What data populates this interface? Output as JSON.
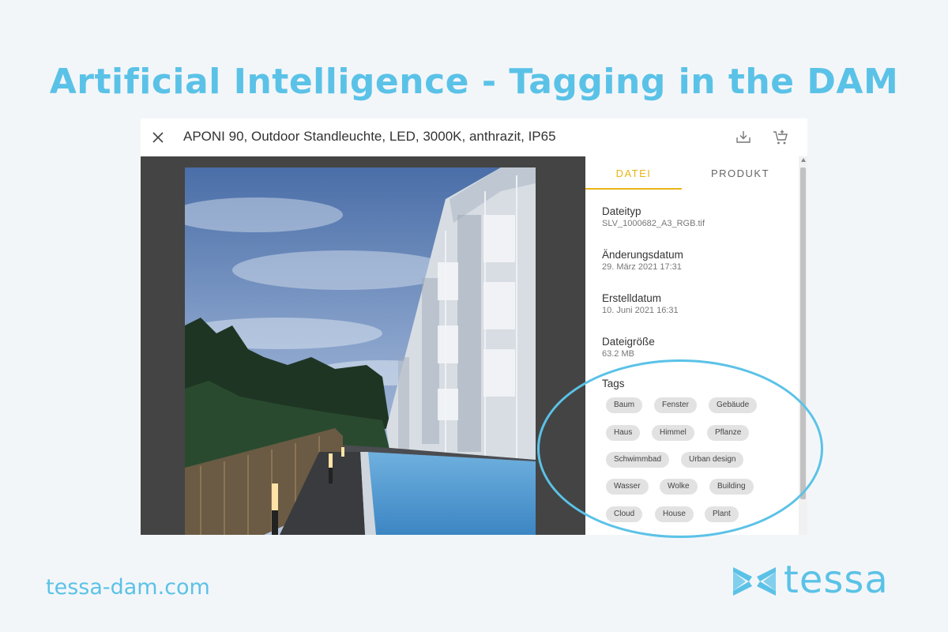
{
  "headline": "Artificial Intelligence - Tagging in the DAM",
  "modal": {
    "title": "APONI 90, Outdoor Standleuchte, LED, 3000K, anthrazit, IP65",
    "close_icon": "close-icon",
    "download_icon": "download-icon",
    "add_to_cart_icon": "cart-add-icon"
  },
  "panel": {
    "tabs": [
      {
        "label": "DATEI",
        "active": true
      },
      {
        "label": "PRODUKT",
        "active": false
      }
    ],
    "fields": [
      {
        "label": "Dateityp",
        "value": "SLV_1000682_A3_RGB.tif"
      },
      {
        "label": "Änderungsdatum",
        "value": "29. März 2021 17:31"
      },
      {
        "label": "Erstelldatum",
        "value": "10. Juni 2021 16:31"
      },
      {
        "label": "Dateigröße",
        "value": "63.2 MB"
      }
    ],
    "tags_label": "Tags",
    "tags": [
      "Baum",
      "Fenster",
      "Gebäude",
      "Haus",
      "Himmel",
      "Pflanze",
      "Schwimmbad",
      "Urban design",
      "Wasser",
      "Wolke",
      "Building",
      "Cloud",
      "House",
      "Plant"
    ]
  },
  "footer": {
    "url": "tessa-dam.com",
    "logo_text": "tessa"
  },
  "colors": {
    "accent": "#5bc2e7",
    "active_tab": "#e8b515",
    "background": "#f3f6f9"
  }
}
